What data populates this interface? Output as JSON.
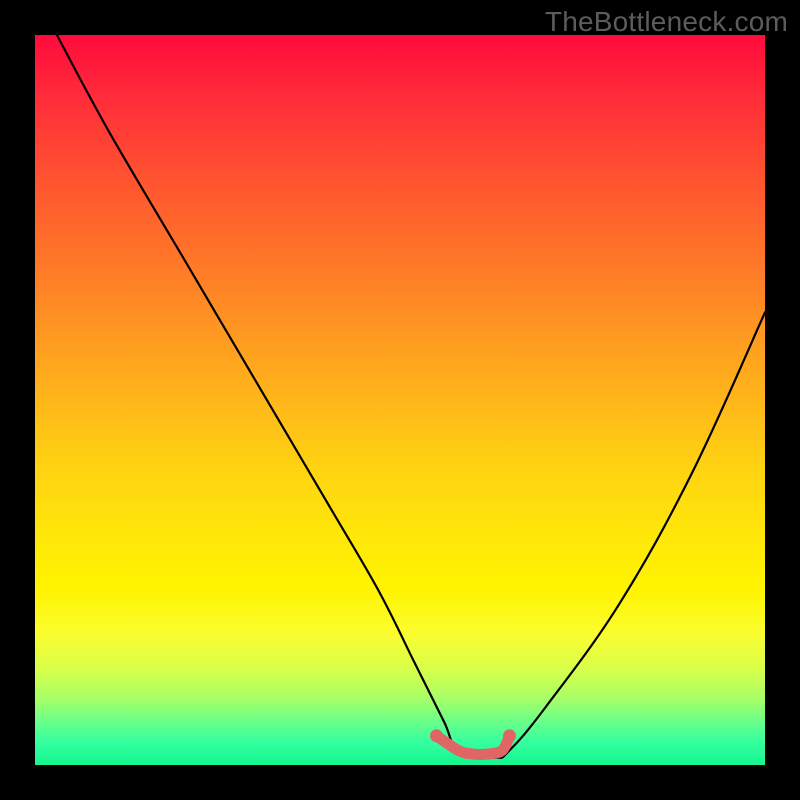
{
  "watermark": "TheBottleneck.com",
  "chart_data": {
    "type": "line",
    "title": "",
    "xlabel": "",
    "ylabel": "",
    "xlim": [
      0,
      100
    ],
    "ylim": [
      0,
      100
    ],
    "series": [
      {
        "name": "curve",
        "color": "#000000",
        "x": [
          3,
          10,
          20,
          30,
          40,
          47,
          52,
          56,
          58,
          63,
          65,
          70,
          80,
          90,
          100
        ],
        "y": [
          100,
          87,
          70,
          53,
          36,
          24,
          14,
          6,
          2,
          1,
          2,
          8,
          22,
          40,
          62
        ]
      },
      {
        "name": "low-band",
        "color": "#e06666",
        "x": [
          55,
          58,
          60,
          62,
          64,
          65
        ],
        "y": [
          4,
          2,
          1.5,
          1.5,
          2,
          4
        ]
      }
    ],
    "background_gradient": {
      "top": "#ff0a3c",
      "mid": "#ffe60a",
      "bottom": "#15f58e"
    }
  }
}
